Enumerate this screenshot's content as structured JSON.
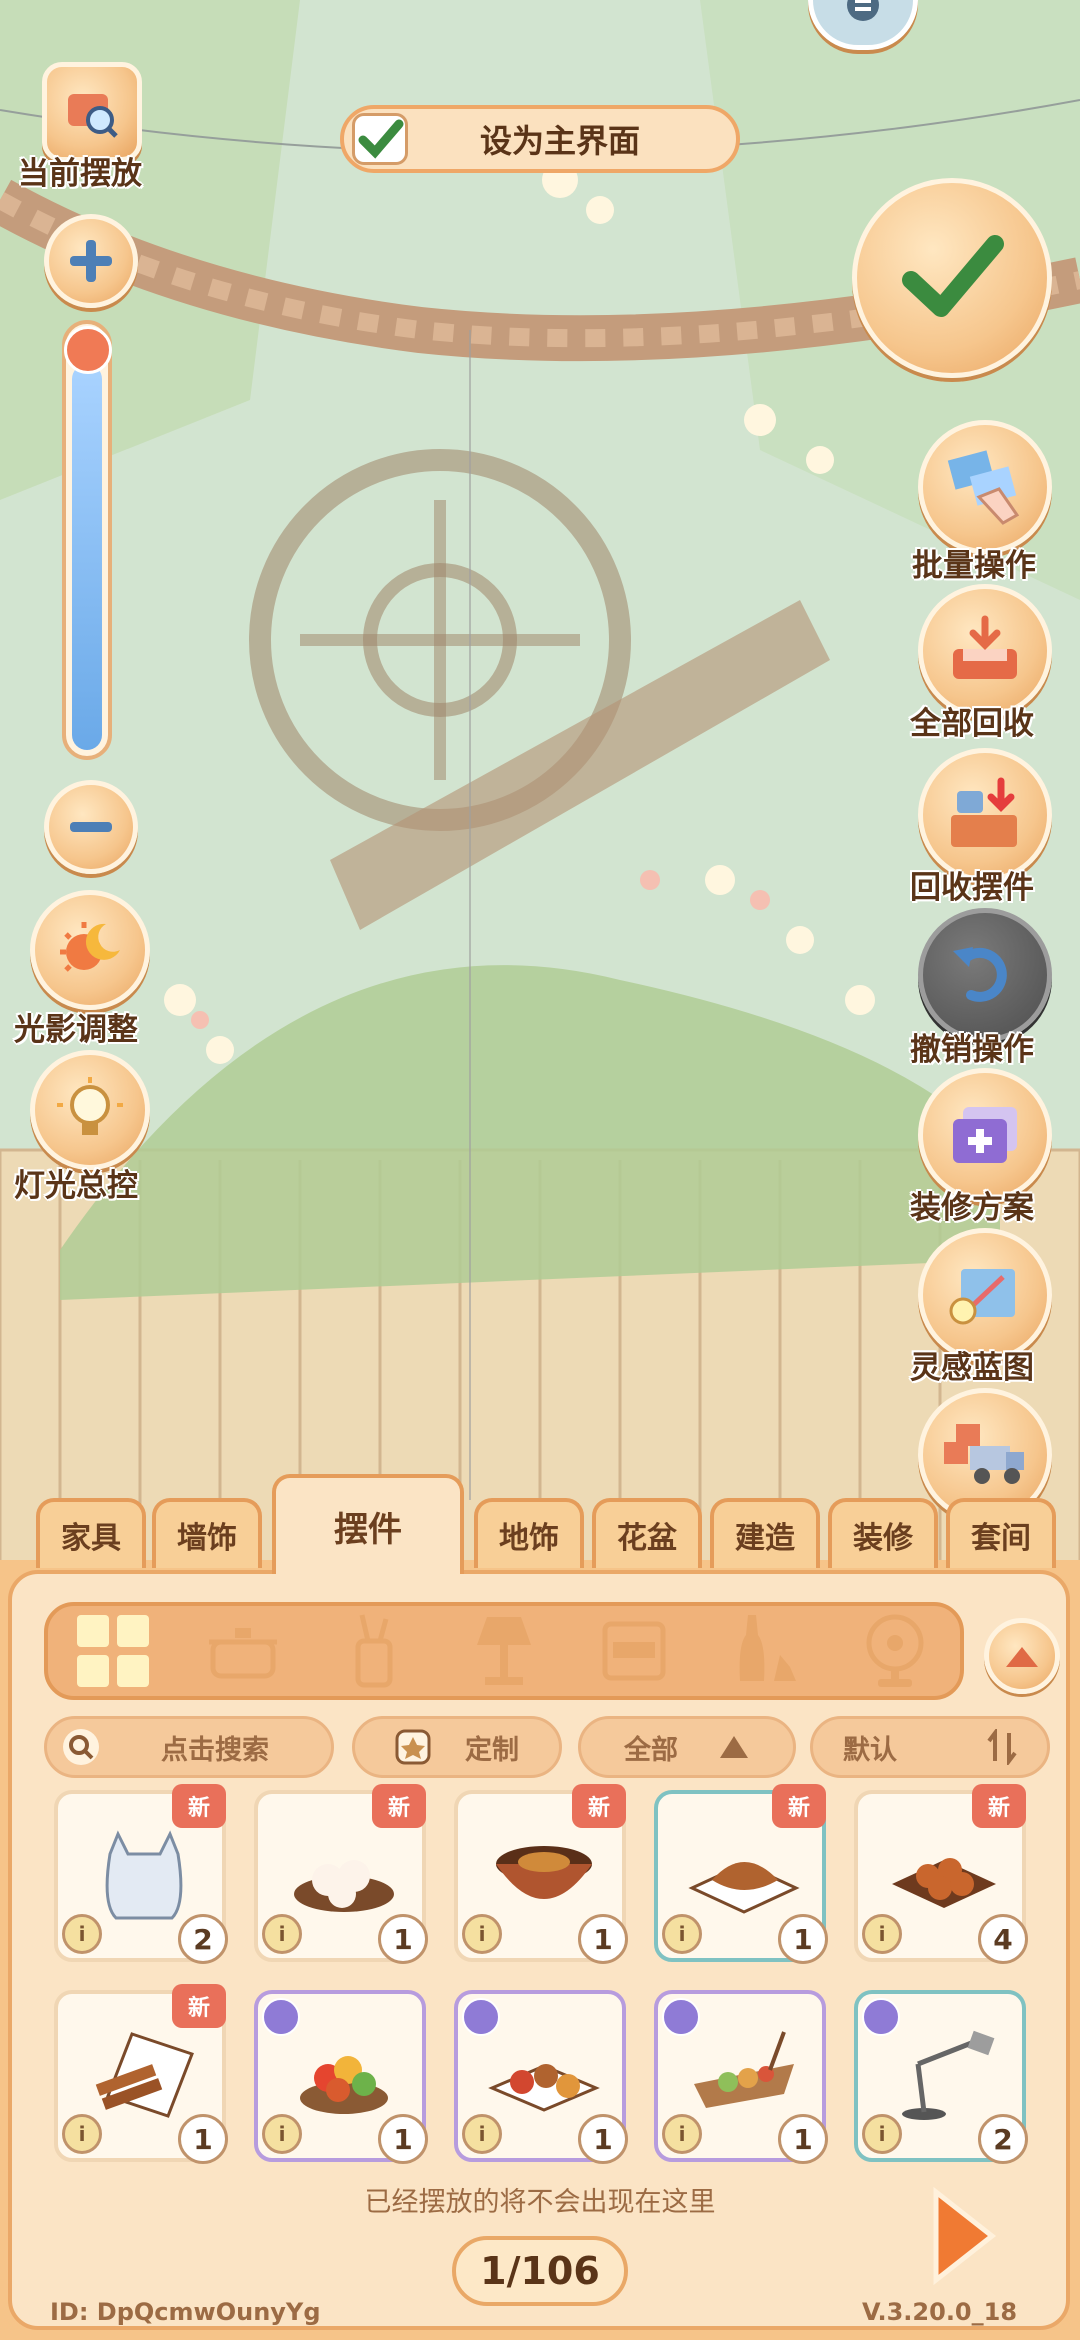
{
  "top": {
    "set_main_label": "设为主界面",
    "current_place_label": "当前摆放"
  },
  "left_controls": {
    "zoom_level": 0.92,
    "light_adjust_label": "光影调整",
    "light_control_label": "灯光总控"
  },
  "right_controls": {
    "batch_label": "批量操作",
    "recycle_all_label": "全部回收",
    "recycle_items_label": "回收摆件",
    "undo_label": "撤销操作",
    "plans_label": "装修方案",
    "blueprint_label": "灵感蓝图"
  },
  "tabs": [
    {
      "label": "家具"
    },
    {
      "label": "墙饰"
    },
    {
      "label": "摆件",
      "active": true
    },
    {
      "label": "地饰"
    },
    {
      "label": "花盆"
    },
    {
      "label": "建造"
    },
    {
      "label": "装修"
    },
    {
      "label": "套间"
    }
  ],
  "filters": {
    "search_placeholder": "点击搜索",
    "custom_label": "定制",
    "all_label": "全部",
    "default_label": "默认"
  },
  "items_row1": [
    {
      "new": "新",
      "count": "2",
      "art": "bag"
    },
    {
      "new": "新",
      "count": "1",
      "art": "dumplings"
    },
    {
      "new": "新",
      "count": "1",
      "art": "bowl"
    },
    {
      "new": "新",
      "count": "1",
      "art": "bread"
    },
    {
      "new": "新",
      "count": "4",
      "art": "balls"
    }
  ],
  "items_row2": [
    {
      "new": "新",
      "count": "1",
      "art": "fries"
    },
    {
      "count": "1",
      "art": "fruit-basket"
    },
    {
      "count": "1",
      "art": "platter"
    },
    {
      "count": "1",
      "art": "boat"
    },
    {
      "count": "2",
      "art": "lamp"
    }
  ],
  "info_glyph": "i",
  "footer": {
    "hint": "已经摆放的将不会出现在这里",
    "page": "1/106",
    "id_text": "ID:  DpQcmwOunyYg",
    "version": "V.3.20.0_18"
  }
}
